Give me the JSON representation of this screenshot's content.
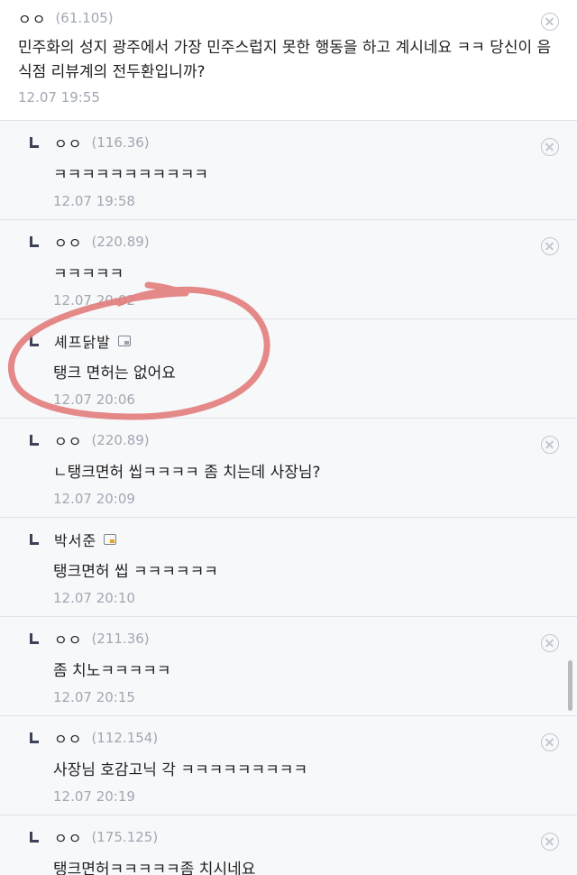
{
  "comments": [
    {
      "nick": "ㅇㅇ",
      "ip": "(61.105)",
      "text": "민주화의 성지 광주에서 가장 민주스럽지 못한 행동을 하고 계시네요 ㅋㅋ 당신이 음식점 리뷰계의 전두환입니까?",
      "date": "12.07 19:55"
    },
    {
      "nick": "ㅇㅇ",
      "ip": "(116.36)",
      "text": "ㅋㅋㅋㅋㅋㅋㅋㅋㅋㅋㅋ",
      "date": "12.07 19:58"
    },
    {
      "nick": "ㅇㅇ",
      "ip": "(220.89)",
      "text": "ㅋㅋㅋㅋㅋ",
      "date": "12.07 20:02"
    },
    {
      "nick": "셰프닭발",
      "ip": "",
      "text": "탱크 면허는 없어요",
      "date": "12.07 20:06"
    },
    {
      "nick": "ㅇㅇ",
      "ip": "(220.89)",
      "text": "ㄴ탱크면허 씹ㅋㅋㅋㅋ 좀 치는데 사장님?",
      "date": "12.07 20:09"
    },
    {
      "nick": "박서준",
      "ip": "",
      "text": "탱크면허 씹 ㅋㅋㅋㅋㅋㅋ",
      "date": "12.07 20:10"
    },
    {
      "nick": "ㅇㅇ",
      "ip": "(211.36)",
      "text": "좀 치노ㅋㅋㅋㅋㅋ",
      "date": "12.07 20:15"
    },
    {
      "nick": "ㅇㅇ",
      "ip": "(112.154)",
      "text": "사장님 호감고닉 각 ㅋㅋㅋㅋㅋㅋㅋㅋㅋ",
      "date": "12.07 20:19"
    },
    {
      "nick": "ㅇㅇ",
      "ip": "(175.125)",
      "text": "탱크면허ㅋㅋㅋㅋㅋ좀 치시네요",
      "date": ""
    }
  ],
  "colors": {
    "root_bg": "#ffffff",
    "reply_bg": "#f7f8fa",
    "divider": "#dfe3ea",
    "meta_text": "#a2a7b2",
    "reply_arrow": "#3b4259",
    "highlight_circle": "#e27b7b"
  },
  "icons": {
    "reply": "reply-arrow-icon",
    "delete": "close-circle-icon",
    "gallery_badge": "fixed-nick-badge-icon"
  }
}
